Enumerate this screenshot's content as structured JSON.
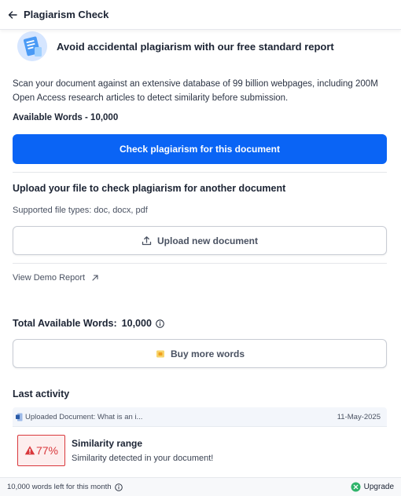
{
  "header": {
    "title": "Plagiarism Check",
    "back_icon": "arrow-left-icon"
  },
  "hero": {
    "title": "Avoid accidental plagiarism with our free standard report",
    "illustration": "document-scan-illustration"
  },
  "description": "Scan your document against an extensive database of 99 billion webpages, including 200M Open Access research articles to detect similarity before submission.",
  "available_words": "Available Words - 10,000",
  "primary_button": "Check plagiarism for this document",
  "upload": {
    "title": "Upload your file to check plagiarism for another document",
    "supported": "Supported file types: doc, docx, pdf",
    "button": "Upload new document",
    "icon": "upload-icon"
  },
  "demo_link": "View Demo Report",
  "total": {
    "label": "Total Available Words:",
    "value": "10,000"
  },
  "buy_button": "Buy more words",
  "last_activity": {
    "title": "Last activity",
    "doc_name": "Uploaded Document: What is an i...",
    "date": "11-May-2025",
    "similarity_value": "77%",
    "similarity_title": "Similarity range",
    "similarity_sub": "Similarity detected in your document!"
  },
  "footer": {
    "words_left": "10,000 words left for this month",
    "upgrade": "Upgrade"
  },
  "colors": {
    "primary": "#0a64f5",
    "danger": "#d9383c",
    "success": "#2fb36a",
    "coin": "#f0b429"
  }
}
